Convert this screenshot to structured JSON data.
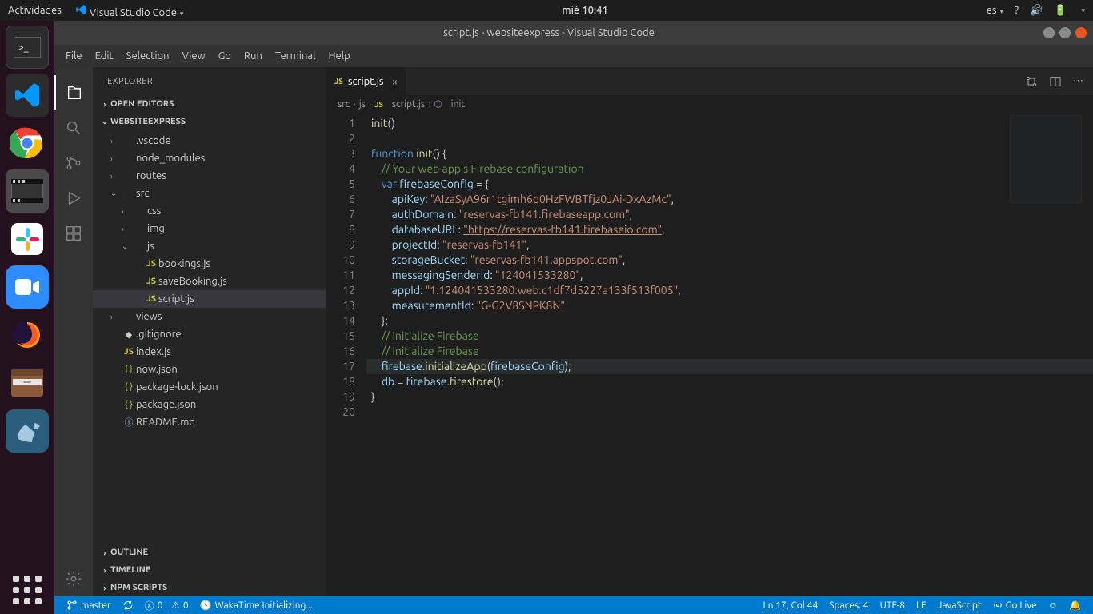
{
  "gnome": {
    "activities": "Actividades",
    "app": "Visual Studio Code",
    "clock": "mié 10:41",
    "lang": "es",
    "battery_pct": ""
  },
  "window_title": "script.js - websiteexpress - Visual Studio Code",
  "menu": [
    "File",
    "Edit",
    "Selection",
    "View",
    "Go",
    "Run",
    "Terminal",
    "Help"
  ],
  "explorer": {
    "title": "EXPLORER",
    "sections": {
      "open_editors": "OPEN EDITORS",
      "workspace": "WEBSITEEXPRESS",
      "outline": "OUTLINE",
      "timeline": "TIMELINE",
      "npm": "NPM SCRIPTS"
    },
    "tree": [
      {
        "depth": 1,
        "kind": "folder",
        "open": false,
        "label": ".vscode"
      },
      {
        "depth": 1,
        "kind": "folder",
        "open": false,
        "label": "node_modules"
      },
      {
        "depth": 1,
        "kind": "folder",
        "open": false,
        "label": "routes"
      },
      {
        "depth": 1,
        "kind": "folder",
        "open": true,
        "label": "src"
      },
      {
        "depth": 2,
        "kind": "folder",
        "open": false,
        "label": "css"
      },
      {
        "depth": 2,
        "kind": "folder",
        "open": false,
        "label": "img"
      },
      {
        "depth": 2,
        "kind": "folder",
        "open": true,
        "label": "js"
      },
      {
        "depth": 3,
        "kind": "js",
        "label": "bookings.js"
      },
      {
        "depth": 3,
        "kind": "js",
        "label": "saveBooking.js"
      },
      {
        "depth": 3,
        "kind": "js",
        "label": "script.js",
        "selected": true
      },
      {
        "depth": 1,
        "kind": "folder",
        "open": false,
        "label": "views"
      },
      {
        "depth": 1,
        "kind": "file",
        "label": ".gitignore"
      },
      {
        "depth": 1,
        "kind": "js",
        "label": "index.js"
      },
      {
        "depth": 1,
        "kind": "json",
        "label": "now.json"
      },
      {
        "depth": 1,
        "kind": "json",
        "label": "package-lock.json"
      },
      {
        "depth": 1,
        "kind": "json",
        "label": "package.json"
      },
      {
        "depth": 1,
        "kind": "info",
        "label": "README.md"
      }
    ]
  },
  "tab": {
    "label": "script.js"
  },
  "breadcrumb": [
    "src",
    "js",
    "script.js",
    "init"
  ],
  "code": {
    "config": {
      "apiKey": "AIzaSyA96r1tgimh6q0HzFWBTfjz0JAi-DxAzMc",
      "authDomain": "reservas-fb141.firebaseapp.com",
      "databaseURL": "https://reservas-fb141.firebaseio.com",
      "projectId": "reservas-fb141",
      "storageBucket": "reservas-fb141.appspot.com",
      "messagingSenderId": "124041533280",
      "appId": "1:124041533280:web:c1df7d5227a133f513f005",
      "measurementId": "G-G2V8SNPK8N"
    }
  },
  "status": {
    "branch": "master",
    "sync": "",
    "errors": "0",
    "warnings": "0",
    "waka": "WakaTime Initializing...",
    "pos": "Ln 17, Col 44",
    "spaces": "Spaces: 4",
    "enc": "UTF-8",
    "eol": "LF",
    "lang": "JavaScript",
    "golive": "Go Live"
  }
}
